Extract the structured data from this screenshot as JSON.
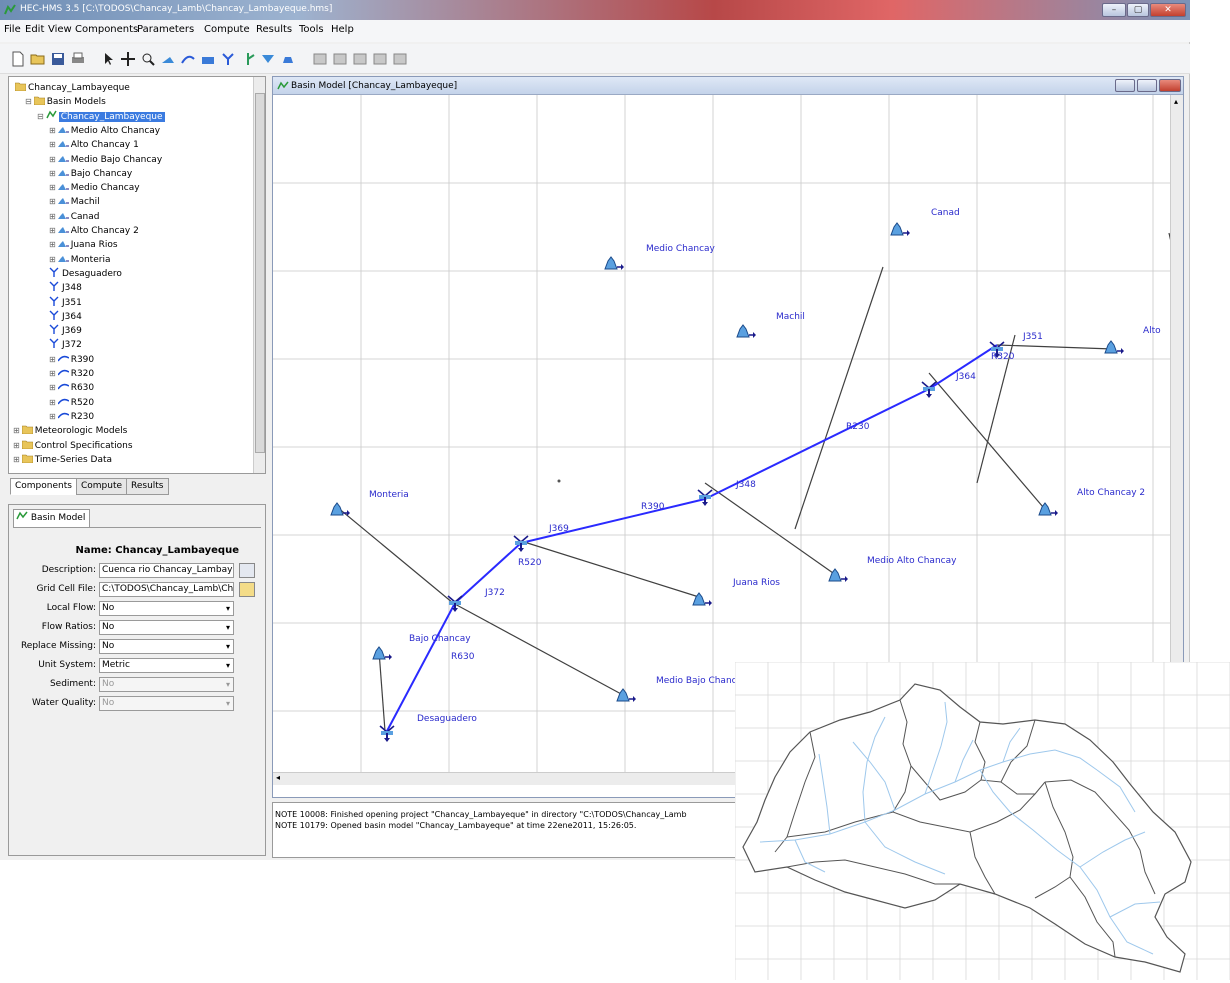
{
  "window": {
    "title": "HEC-HMS 3.5 [C:\\TODOS\\Chancay_Lamb\\Chancay_Lambayeque.hms]",
    "buttons": [
      "–",
      "▢",
      "✕"
    ]
  },
  "menubar": [
    "File",
    "Edit",
    "View",
    "Components",
    "Parameters",
    "Compute",
    "Results",
    "Tools",
    "Help"
  ],
  "toolbar_icons": [
    "new-icon",
    "open-icon",
    "save-icon",
    "print-icon",
    "arrow-tool-icon",
    "pan-tool-icon",
    "zoom-tool-icon",
    "subbasin-tool-icon",
    "reach-tool-icon",
    "reservoir-tool-icon",
    "junction-tool-icon",
    "diversion-tool-icon",
    "source-tool-icon",
    "sink-tool-icon",
    "results-icon-1",
    "results-icon-2",
    "results-icon-3",
    "results-icon-4",
    "results-icon-5"
  ],
  "tree": {
    "items": [
      {
        "label": "Chancay_Lambayeque",
        "type": "folder",
        "level": 0
      },
      {
        "label": "Basin Models",
        "type": "folder",
        "level": 1
      },
      {
        "label": "Chancay_Lambayeque",
        "type": "basin",
        "level": 2,
        "selected": true
      },
      {
        "label": "Medio Alto Chancay",
        "type": "subbasin",
        "level": 3
      },
      {
        "label": "Alto Chancay 1",
        "type": "subbasin",
        "level": 3
      },
      {
        "label": "Medio Bajo Chancay",
        "type": "subbasin",
        "level": 3
      },
      {
        "label": "Bajo Chancay",
        "type": "subbasin",
        "level": 3
      },
      {
        "label": "Medio Chancay",
        "type": "subbasin",
        "level": 3
      },
      {
        "label": "Machil",
        "type": "subbasin",
        "level": 3
      },
      {
        "label": "Canad",
        "type": "subbasin",
        "level": 3
      },
      {
        "label": "Alto Chancay 2",
        "type": "subbasin",
        "level": 3
      },
      {
        "label": "Juana Rios",
        "type": "subbasin",
        "level": 3
      },
      {
        "label": "Monteria",
        "type": "subbasin",
        "level": 3
      },
      {
        "label": "Desaguadero",
        "type": "junction",
        "level": 3
      },
      {
        "label": "J348",
        "type": "junction",
        "level": 3
      },
      {
        "label": "J351",
        "type": "junction",
        "level": 3
      },
      {
        "label": "J364",
        "type": "junction",
        "level": 3
      },
      {
        "label": "J369",
        "type": "junction",
        "level": 3
      },
      {
        "label": "J372",
        "type": "junction",
        "level": 3
      },
      {
        "label": "R390",
        "type": "reach",
        "level": 3
      },
      {
        "label": "R320",
        "type": "reach",
        "level": 3
      },
      {
        "label": "R630",
        "type": "reach",
        "level": 3
      },
      {
        "label": "R520",
        "type": "reach",
        "level": 3
      },
      {
        "label": "R230",
        "type": "reach",
        "level": 3
      },
      {
        "label": "Meteorologic Models",
        "type": "folder",
        "level": 0
      },
      {
        "label": "Control Specifications",
        "type": "folder",
        "level": 0
      },
      {
        "label": "Time-Series Data",
        "type": "folder",
        "level": 0
      }
    ]
  },
  "left_tabs": [
    "Components",
    "Compute",
    "Results"
  ],
  "props": {
    "tab": "Basin Model",
    "name_label": "Name:",
    "name_value": "Chancay_Lambayeque",
    "rows": [
      {
        "label": "Description:",
        "value": "Cuenca rio Chancay_Lambaye",
        "kind": "text"
      },
      {
        "label": "Grid Cell File:",
        "value": "C:\\TODOS\\Chancay_Lamb\\Ch",
        "kind": "file"
      },
      {
        "label": "Local Flow:",
        "value": "No",
        "kind": "select"
      },
      {
        "label": "Flow Ratios:",
        "value": "No",
        "kind": "select"
      },
      {
        "label": "Replace Missing:",
        "value": "No",
        "kind": "select"
      },
      {
        "label": "Unit System:",
        "value": "Metric",
        "kind": "select"
      },
      {
        "label": "Sediment:",
        "value": "No",
        "kind": "disabled"
      },
      {
        "label": "Water Quality:",
        "value": "No",
        "kind": "disabled"
      }
    ]
  },
  "basin_window": {
    "title": "Basin Model [Chancay_Lambayeque]"
  },
  "map_labels": {
    "canad": "Canad",
    "medio_chancay": "Medio Chancay",
    "machil": "Machil",
    "j351": "J351",
    "alto1": "Alto",
    "r320": "R320",
    "j364": "J364",
    "r230": "R230",
    "j348": "J348",
    "alto_chancay_2": "Alto Chancay 2",
    "r390": "R390",
    "monteria": "Monteria",
    "j369": "J369",
    "r520": "R520",
    "medio_alto_chancay": "Medio Alto Chancay",
    "juana_rios": "Juana Rios",
    "j372": "J372",
    "bajo_chancay": "Bajo Chancay",
    "r630": "R630",
    "medio_bajo_chancay": "Medio Bajo Chancay",
    "desaguadero": "Desaguadero"
  },
  "console": [
    "NOTE 10008:  Finished opening project \"Chancay_Lambayeque\" in directory \"C:\\TODOS\\Chancay_Lamb",
    "NOTE 10179:  Opened basin model \"Chancay_Lambayeque\" at time 22ene2011, 15:26:05."
  ],
  "colors": {
    "reach_line": "#2a2aff",
    "link_line": "#404040",
    "label_text": "#2a2acc",
    "stream": "#9ec8ec",
    "watershed_border": "#555555"
  }
}
